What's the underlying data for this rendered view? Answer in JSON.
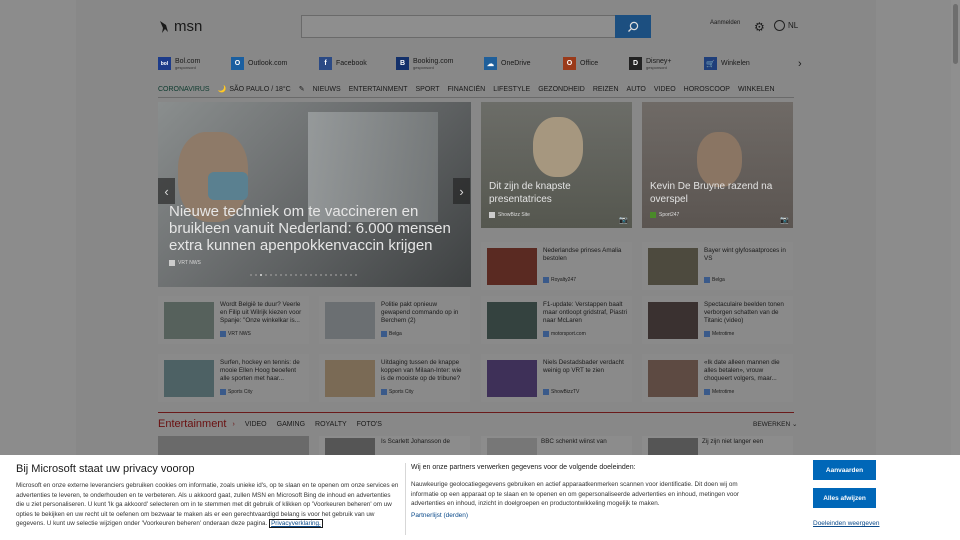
{
  "header": {
    "logo_text": "msn",
    "signin": "Aanmelden",
    "language": "NL"
  },
  "quicklinks": [
    {
      "label": "Bol.com",
      "sub": "gesponsord",
      "icon": "bol-icon",
      "color": "#1c3b8a",
      "glyph": "bol"
    },
    {
      "label": "Outlook.com",
      "sub": "",
      "icon": "outlook-icon",
      "color": "#1a5fa0",
      "glyph": "O"
    },
    {
      "label": "Facebook",
      "sub": "",
      "icon": "facebook-icon",
      "color": "#2b4a85",
      "glyph": "f"
    },
    {
      "label": "Booking.com",
      "sub": "gesponsord",
      "icon": "booking-icon",
      "color": "#13306a",
      "glyph": "B"
    },
    {
      "label": "OneDrive",
      "sub": "",
      "icon": "onedrive-icon",
      "color": "#1f5f9a",
      "glyph": "☁"
    },
    {
      "label": "Office",
      "sub": "",
      "icon": "office-icon",
      "color": "#9a3a1a",
      "glyph": "O"
    },
    {
      "label": "Disney+",
      "sub": "gesponsord",
      "icon": "disney-icon",
      "color": "#222",
      "glyph": "D"
    },
    {
      "label": "Winkelen",
      "sub": "",
      "icon": "cart-icon",
      "color": "#1f3f7a",
      "glyph": "🛒"
    }
  ],
  "nav": {
    "corona": "CORONAVIRUS",
    "weather": "SÃO PAULO / 18°C",
    "items": [
      "NIEUWS",
      "ENTERTAINMENT",
      "SPORT",
      "FINANCIËN",
      "LIFESTYLE",
      "GEZONDHEID",
      "REIZEN",
      "AUTO",
      "VIDEO",
      "HOROSCOOP",
      "WINKELEN"
    ]
  },
  "hero": {
    "title": "Nieuwe techniek om te vaccineren en bruikleen vanuit Nederland: 6.000 mensen extra kunnen apenpokkenvaccin krijgen",
    "source": "VRT NWS"
  },
  "big_cards": [
    {
      "title": "Dit zijn de knapste presentatrices",
      "source": "ShowBizz Site"
    },
    {
      "title": "Kevin De Bruyne razend na overspel",
      "source": "Sport247"
    }
  ],
  "small_cards": [
    {
      "text": "Nederlandse prinses Amalia bestolen",
      "source": "Royalty247",
      "color": "#5a2a22"
    },
    {
      "text": "Bayer wint glyfosaatproces in VS",
      "source": "Belga",
      "color": "#4d4a3e"
    },
    {
      "text": "Wordt België te duur? Veerle en Filip uit Wilrijk kiezen voor Spanje: \"Onze winkelkar is...",
      "source": "VRT NWS",
      "color": "#56615c"
    },
    {
      "text": "Politie pakt opnieuw gewapend commando op in Berchem (2)",
      "source": "Belga",
      "color": "#6b6f72"
    },
    {
      "text": "F1-update: Verstappen baalt maar ontloopt gridstraf, Piastri naar McLaren",
      "source": "motorsport.com",
      "color": "#34423f"
    },
    {
      "text": "Spectaculaire beelden tonen verborgen schatten van de Titanic (video)",
      "source": "Metrotime",
      "color": "#3a3130"
    },
    {
      "text": "Surfen, hockey en tennis: de mooie Ellen Hoog beoefent alle sporten met haar...",
      "source": "Sports City",
      "color": "#4d6164"
    },
    {
      "text": "Uitdaging tussen de knappe koppen van Milaan-Inter: wie is de mooiste op de tribune?",
      "source": "Sports City",
      "color": "#7a6a55"
    },
    {
      "text": "Niels Destadsbader verdacht weinig op VRT te zien",
      "source": "ShowBizzTV",
      "color": "#3e3058"
    },
    {
      "text": "«Ik date alleen mannen die alles betalen», vrouw choqueert volgers, maar...",
      "source": "Metrotime",
      "color": "#5d4a42"
    }
  ],
  "entertainment": {
    "heading": "Entertainment",
    "tabs": [
      "VIDEO",
      "GAMING",
      "ROYALTY",
      "FOTO'S"
    ],
    "more": "BEWERKEN",
    "peek": [
      "Is Scarlett Johansson de",
      "BBC schenkt wiinst van",
      "Zij zijn niet langer een"
    ]
  },
  "banner": {
    "title": "Bij Microsoft staat uw privacy voorop",
    "text": "Microsoft en onze externe leveranciers gebruiken cookies om informatie, zoals unieke id's, op te slaan en te openen om onze services en advertenties te leveren, te onderhouden en te verbeteren. Als u akkoord gaat, zullen MSN en Microsoft Bing de inhoud en advertenties die u ziet personaliseren. U kunt 'Ik ga akkoord' selecteren om in te stemmen met dit gebruik of klikken op 'Voorkeuren beheren' om uw opties te bekijken en uw recht uit te oefenen om bezwaar te maken als er een gerechtvaardigd belang is voor het gebruik van uw gegevens. U kunt uw selectie wijzigen onder 'Voorkeuren beheren' onderaan deze pagina.",
    "privacy_link": "Privacyverklaring.",
    "title2": "Wij en onze partners verwerken gegevens voor de volgende doeleinden:",
    "text2": "Nauwkeurige geolocatiegegevens gebruiken en actief apparaatkenmerken scannen voor identificatie. Dit doen wij om informatie op een apparaat op te slaan en te openen en om gepersonaliseerde advertenties en inhoud, metingen voor advertenties en inhoud, inzicht in doelgroepen en productontwikkeling mogelijk te maken.",
    "partners": "Partnerlijst (derden)",
    "accept": "Aanvaarden",
    "reject": "Alles afwijzen",
    "manage": "Doeleinden weergeven"
  }
}
